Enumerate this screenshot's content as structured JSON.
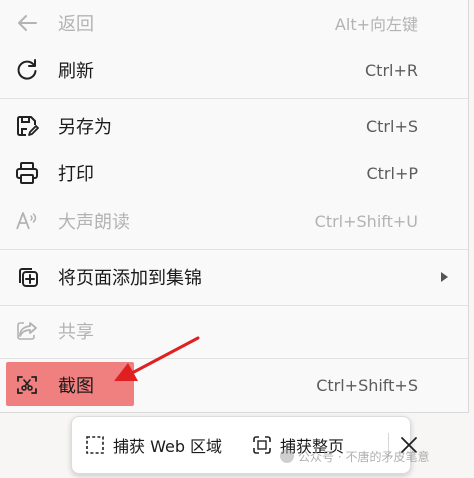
{
  "menu": {
    "items": [
      {
        "label": "返回",
        "shortcut": "Alt+向左键",
        "icon": "back-arrow-icon"
      },
      {
        "label": "刷新",
        "shortcut": "Ctrl+R",
        "icon": "refresh-icon"
      },
      {
        "label": "另存为",
        "shortcut": "Ctrl+S",
        "icon": "save-as-icon"
      },
      {
        "label": "打印",
        "shortcut": "Ctrl+P",
        "icon": "printer-icon"
      },
      {
        "label": "大声朗读",
        "shortcut": "Ctrl+Shift+U",
        "icon": "read-aloud-icon"
      },
      {
        "label": "将页面添加到集锦",
        "icon": "add-to-collections-icon"
      },
      {
        "label": "共享",
        "icon": "share-icon"
      },
      {
        "label": "截图",
        "shortcut": "Ctrl+Shift+S",
        "icon": "screenshot-icon"
      }
    ]
  },
  "highlight_color": "#f08080",
  "annotation_arrow_color": "#e02020",
  "capture_toolbar": {
    "capture_area_label": "捕获 Web 区域",
    "capture_full_label": "捕获整页"
  },
  "watermark": "公众号 · 不唐的矛皮笔意"
}
